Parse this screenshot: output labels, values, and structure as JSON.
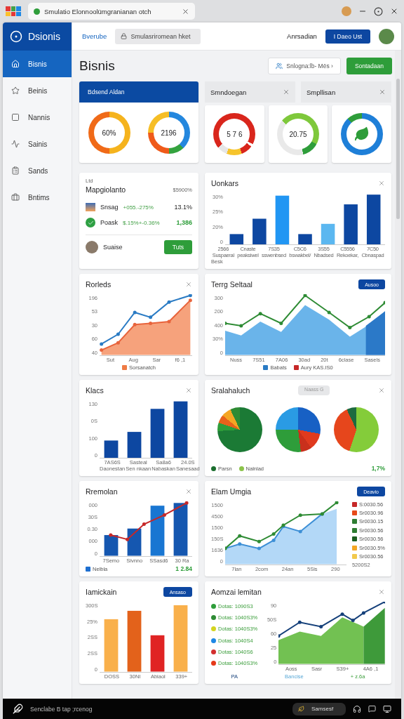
{
  "browser": {
    "tab_title": "Smulatio Elonnoolümgranianan otch"
  },
  "sidebar": {
    "brand": "Dsionis",
    "items": [
      {
        "label": "Bisnis",
        "selected": true
      },
      {
        "label": "Beinis",
        "selected": false
      },
      {
        "label": "Nannis",
        "selected": false
      },
      {
        "label": "Sainis",
        "selected": false
      },
      {
        "label": "Sands",
        "selected": false
      },
      {
        "label": "Bntims",
        "selected": false
      }
    ]
  },
  "header": {
    "link": "Bverube",
    "search": "Smulasriromean hket",
    "account": "Anrsadian",
    "button": "I Daeo Ust"
  },
  "page": {
    "title": "Bisnis",
    "filter": "Snlogna:lb- Mës ›",
    "action": "Sontadaan"
  },
  "summary": {
    "title": "Bdsend Aldan",
    "gauges": [
      {
        "kind": "orange",
        "value": "60%"
      },
      {
        "kind": "split",
        "value": "2196"
      }
    ]
  },
  "panels": [
    {
      "title": "Smndoegan"
    },
    {
      "title": "Smpllisan"
    }
  ],
  "gauges": [
    {
      "kind": "red",
      "value": "5 7 6"
    },
    {
      "kind": "green",
      "value": "20.75"
    },
    {
      "kind": "leaf"
    }
  ],
  "cards": [
    {
      "kind": "portfolio",
      "tag": "Ltd",
      "title": "Mapgiolanto",
      "total": "$5900%",
      "rows": [
        {
          "name": "Snsag",
          "change": "+055.-275%",
          "value": "13.1%",
          "highlight": false
        },
        {
          "name": "Poask",
          "change": "$.15%+-0.36%",
          "value": "1,386",
          "highlight": true
        }
      ],
      "user": "Suaise",
      "button": "Tuts"
    },
    {
      "kind": "chart",
      "title": "Uonkars",
      "closable": true,
      "y_labels": [
        "30%",
        "25%",
        "20%",
        "0"
      ],
      "x_labels": [
        "2566",
        "Cnaste",
        "7S35",
        "C5C6",
        "3S55",
        "C5556",
        "7C50"
      ],
      "x_sublabels": [
        "Suspaeral",
        "peaksiwel",
        "sswenbsed",
        "bswakbel/",
        "Nbadsed",
        "Rekoekar,",
        "Cbnaspad"
      ],
      "note": "Besk"
    },
    {
      "kind": "chart",
      "title": "Rorleds",
      "closable": true,
      "y_labels": [
        "196",
        "53",
        "30",
        "60",
        "40"
      ],
      "x_labels": [
        "Sut",
        "Aug",
        "Sar",
        "f6 ,1"
      ],
      "legend": [
        {
          "label": "Sorsanatch",
          "color": "#ef7b45"
        }
      ]
    },
    {
      "kind": "chart",
      "title": "Terrg Seltaal",
      "button": "Ausoo",
      "y_labels": [
        "300",
        "200",
        "400",
        "30%",
        "0"
      ],
      "x_labels": [
        "Nuss",
        "7S51",
        "7A06",
        "30ad",
        "20t",
        "6clase",
        "Sasels"
      ],
      "legend": [
        {
          "label": "Babats",
          "color": "#2a7bc4"
        },
        {
          "label": "Aury KAS.IS0",
          "color": "#c62828"
        }
      ]
    },
    {
      "kind": "chart",
      "title": "Klacs",
      "closable": true,
      "y_labels": [
        "130",
        "0S",
        "100",
        "0"
      ],
      "x_labels": [
        "7AS6S",
        "Sasteal",
        "Sa8a6",
        "24.0S"
      ],
      "x_sublabels": [
        "Daonestan",
        "Sen nkaan",
        "Nabaskan",
        "Sanesaad"
      ]
    },
    {
      "kind": "pies",
      "title": "Sralahaluch",
      "pill": "Naass G",
      "closable": true,
      "legend": [
        {
          "label": "Parsn",
          "color": "#1b6e2e"
        },
        {
          "label": "Nalnlad",
          "color": "#8bc34a"
        }
      ],
      "value": "1,7%"
    },
    {
      "kind": "chart",
      "title": "Rremolan",
      "closable": true,
      "y_labels": [
        "000",
        "30S",
        "0.30",
        "000",
        "0"
      ],
      "x_labels": [
        "7Semo",
        "Sivnno",
        "SSasd6",
        "30 Ra"
      ],
      "legend": [
        {
          "label": "Nelbla",
          "color": "#1e6fd0"
        }
      ],
      "value": "1 2.84"
    },
    {
      "kind": "chart-legend-right",
      "title": "Elam Umgia",
      "button": "Deavio",
      "y_labels": [
        "1500",
        "4500",
        "1500",
        "150S",
        "1636",
        "0"
      ],
      "x_labels": [
        "7lan",
        "2com",
        "24an",
        "5Sis",
        "290"
      ],
      "legend": [
        {
          "label": "S:0030.56",
          "color": "#c62828"
        },
        {
          "label": "Sr0030.96",
          "color": "#e64a19"
        },
        {
          "label": "Sr0030.15",
          "color": "#2e7d32"
        },
        {
          "label": "Sr0030.56",
          "color": "#2e7d32"
        },
        {
          "label": "Sr0030.56",
          "color": "#1b5e20"
        },
        {
          "label": "Sr0030.5%",
          "color": "#f4a623"
        },
        {
          "label": "Sr0030.56",
          "color": "#f2c94c"
        }
      ],
      "footer": "5200S2"
    },
    {
      "kind": "chart",
      "title": "Iamickain",
      "button": "Ansaso",
      "y_labels": [
        "300S",
        "25%",
        "2SS",
        "2SS",
        "0"
      ],
      "x_labels": [
        "DOSS",
        "30NI",
        "Abiaol",
        "339+"
      ]
    },
    {
      "kind": "chart-legend-left",
      "title": "Aomzai lemitan",
      "closable": true,
      "y_labels": [
        "90",
        "50S",
        "60",
        "25",
        "0"
      ],
      "x_labels": [
        "Aoss",
        "Sasr",
        "S39+",
        "4A6 ,1"
      ],
      "legend": [
        {
          "label": "Dotas: 1090S3",
          "color": "#2e9d3a"
        },
        {
          "label": "Dotas: 1040S3%",
          "color": "#2e8b34"
        },
        {
          "label": "Dotas: 1040S3%",
          "color": "#d4d41f"
        },
        {
          "label": "Dotas: 1040S4",
          "color": "#1e88e5"
        },
        {
          "label": "Dotas: 1040S6",
          "color": "#d32f2f"
        },
        {
          "label": "Dotas: 1040S3%",
          "color": "#e53919"
        }
      ],
      "footer_labels": [
        "PA",
        "Bancise",
        "+ z.6a"
      ]
    }
  ],
  "taskbar": {
    "label": "Senclabe B tap ;rcenog",
    "pill": "Samsesf"
  }
}
